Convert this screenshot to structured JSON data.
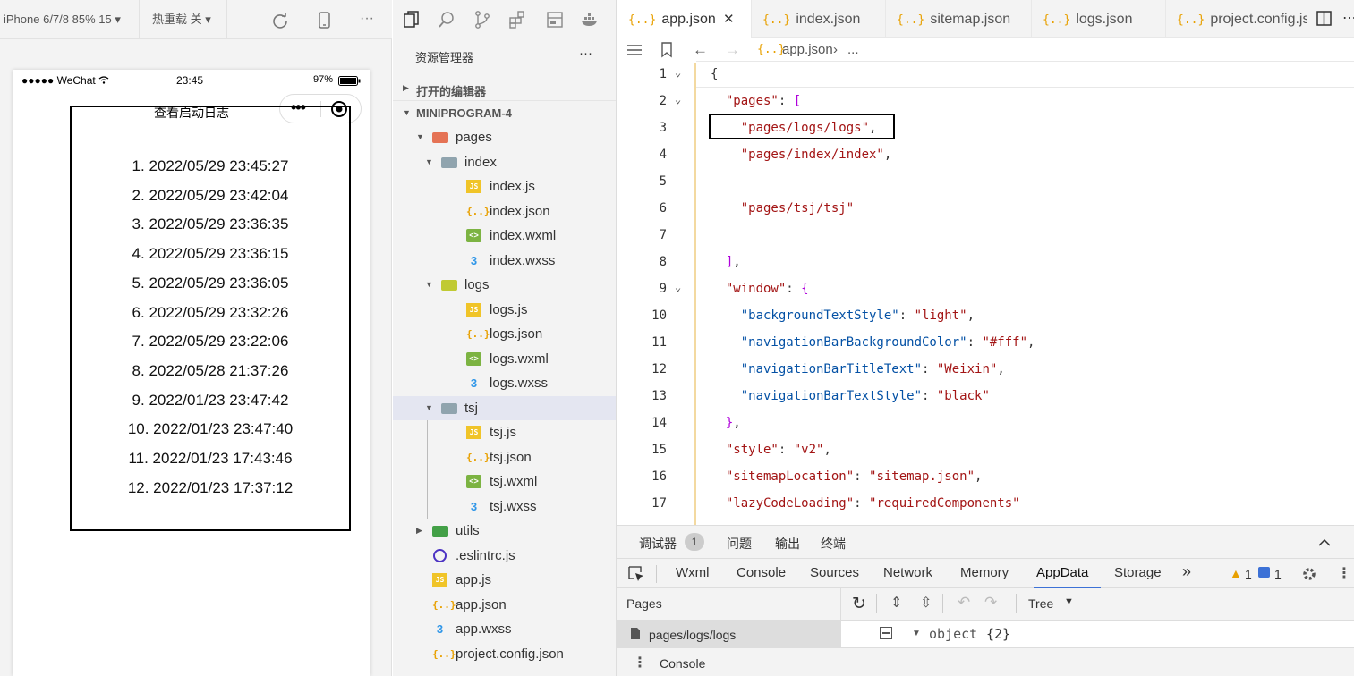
{
  "simulator": {
    "device_label": "iPhone 6/7/8 85% 15 ▾",
    "hot_reload_label": "热重载 关 ▾",
    "status": {
      "carrier": "●●●●● WeChat",
      "time": "23:45",
      "battery": "97%"
    },
    "nav_title": "查看启动日志",
    "logs": [
      "1. 2022/05/29 23:45:27",
      "2. 2022/05/29 23:42:04",
      "3. 2022/05/29 23:36:35",
      "4. 2022/05/29 23:36:15",
      "5. 2022/05/29 23:36:05",
      "6. 2022/05/29 23:32:26",
      "7. 2022/05/29 23:22:06",
      "8. 2022/05/28 21:37:26",
      "9. 2022/01/23 23:47:42",
      "10. 2022/01/23 23:47:40",
      "11. 2022/01/23 17:43:46",
      "12. 2022/01/23 17:37:12"
    ]
  },
  "explorer": {
    "title": "资源管理器",
    "more": "···",
    "open_editors": "打开的编辑器",
    "project": "MINIPROGRAM-4",
    "tree": [
      {
        "label": "pages",
        "type": "folder-pages",
        "depth": 1,
        "arrow": "▼"
      },
      {
        "label": "index",
        "type": "folder",
        "depth": 2,
        "arrow": "▼"
      },
      {
        "label": "index.js",
        "type": "js",
        "depth": 3
      },
      {
        "label": "index.json",
        "type": "json",
        "depth": 3
      },
      {
        "label": "index.wxml",
        "type": "wxml",
        "depth": 3
      },
      {
        "label": "index.wxss",
        "type": "wxss",
        "depth": 3
      },
      {
        "label": "logs",
        "type": "folder-logs",
        "depth": 2,
        "arrow": "▼"
      },
      {
        "label": "logs.js",
        "type": "js",
        "depth": 3
      },
      {
        "label": "logs.json",
        "type": "json",
        "depth": 3
      },
      {
        "label": "logs.wxml",
        "type": "wxml",
        "depth": 3
      },
      {
        "label": "logs.wxss",
        "type": "wxss",
        "depth": 3
      },
      {
        "label": "tsj",
        "type": "folder",
        "depth": 2,
        "arrow": "▼",
        "selected": true
      },
      {
        "label": "tsj.js",
        "type": "js",
        "depth": 3
      },
      {
        "label": "tsj.json",
        "type": "json",
        "depth": 3
      },
      {
        "label": "tsj.wxml",
        "type": "wxml",
        "depth": 3
      },
      {
        "label": "tsj.wxss",
        "type": "wxss",
        "depth": 3
      },
      {
        "label": "utils",
        "type": "folder-utils",
        "depth": 1,
        "arrow": "▶"
      },
      {
        "label": ".eslintrc.js",
        "type": "eslint",
        "depth": 1
      },
      {
        "label": "app.js",
        "type": "js",
        "depth": 1
      },
      {
        "label": "app.json",
        "type": "json",
        "depth": 1
      },
      {
        "label": "app.wxss",
        "type": "wxss",
        "depth": 1
      },
      {
        "label": "project.config.json",
        "type": "json",
        "depth": 1
      }
    ]
  },
  "editor": {
    "tabs": [
      {
        "label": "app.json",
        "active": true,
        "close": "✕"
      },
      {
        "label": "index.json"
      },
      {
        "label": "sitemap.json"
      },
      {
        "label": "logs.json"
      },
      {
        "label": "project.config.js"
      }
    ],
    "breadcrumb": {
      "file": "app.json",
      "sep": "›",
      "more": "..."
    },
    "lines": [
      {
        "n": "1",
        "html": "<span class='p'>{</span>"
      },
      {
        "n": "2",
        "html": "  <span class='k'>\"pages\"</span><span class='p'>: </span><span class='b'>[</span>"
      },
      {
        "n": "3",
        "html": "    <span class='s'>\"pages/logs/logs\"</span><span class='p'>,</span>"
      },
      {
        "n": "4",
        "html": "    <span class='s'>\"pages/index/index\"</span><span class='p'>,</span>"
      },
      {
        "n": "5",
        "html": ""
      },
      {
        "n": "6",
        "html": "    <span class='s'>\"pages/tsj/tsj\"</span>"
      },
      {
        "n": "7",
        "html": ""
      },
      {
        "n": "8",
        "html": "  <span class='b'>]</span><span class='p'>,</span>"
      },
      {
        "n": "9",
        "html": "  <span class='k'>\"window\"</span><span class='p'>: </span><span class='b'>{</span>"
      },
      {
        "n": "10",
        "html": "    <span class='k2'>\"backgroundTextStyle\"</span><span class='p'>: </span><span class='s'>\"light\"</span><span class='p'>,</span>"
      },
      {
        "n": "11",
        "html": "    <span class='k2'>\"navigationBarBackgroundColor\"</span><span class='p'>: </span><span class='s'>\"#fff\"</span><span class='p'>,</span>"
      },
      {
        "n": "12",
        "html": "    <span class='k2'>\"navigationBarTitleText\"</span><span class='p'>: </span><span class='s'>\"Weixin\"</span><span class='p'>,</span>"
      },
      {
        "n": "13",
        "html": "    <span class='k2'>\"navigationBarTextStyle\"</span><span class='p'>: </span><span class='s'>\"black\"</span>"
      },
      {
        "n": "14",
        "html": "  <span class='b'>}</span><span class='p'>,</span>"
      },
      {
        "n": "15",
        "html": "  <span class='k'>\"style\"</span><span class='p'>: </span><span class='s'>\"v2\"</span><span class='p'>,</span>"
      },
      {
        "n": "16",
        "html": "  <span class='k'>\"sitemapLocation\"</span><span class='p'>: </span><span class='s'>\"sitemap.json\"</span><span class='p'>,</span>"
      },
      {
        "n": "17",
        "html": "  <span class='k'>\"lazyCodeLoading\"</span><span class='p'>: </span><span class='s'>\"requiredComponents\"</span>"
      }
    ]
  },
  "debugger": {
    "top_tabs": [
      "调试器",
      "问题",
      "输出",
      "终端"
    ],
    "badge": "1",
    "panel_tabs": [
      "Wxml",
      "Console",
      "Sources",
      "Network",
      "Memory",
      "AppData",
      "Storage"
    ],
    "active_panel": "AppData",
    "more": "»",
    "warn_count": "1",
    "info_count": "1",
    "pages_header": "Pages",
    "page_item": "pages/logs/logs",
    "view_mode": "Tree",
    "object_text": "object",
    "object_count": "{2}",
    "console_label": "Console"
  },
  "colors": {
    "accent": "#3c71d6",
    "warn": "#e8a000",
    "json_icon": "#e8a000"
  }
}
